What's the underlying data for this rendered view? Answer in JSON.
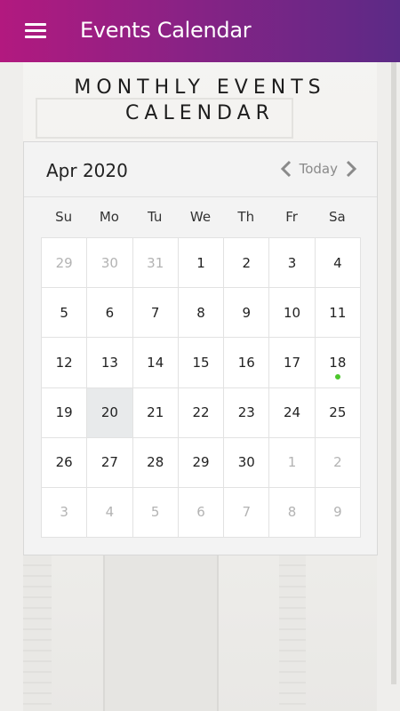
{
  "appbar": {
    "title": "Events Calendar"
  },
  "page": {
    "heading": "MONTHLY EVENTS CALENDAR"
  },
  "calendar": {
    "month_label": "Apr 2020",
    "today_label": "Today",
    "weekdays": [
      "Su",
      "Mo",
      "Tu",
      "We",
      "Th",
      "Fr",
      "Sa"
    ],
    "weeks": [
      [
        {
          "d": "29",
          "muted": true
        },
        {
          "d": "30",
          "muted": true
        },
        {
          "d": "31",
          "muted": true
        },
        {
          "d": "1"
        },
        {
          "d": "2"
        },
        {
          "d": "3"
        },
        {
          "d": "4"
        }
      ],
      [
        {
          "d": "5"
        },
        {
          "d": "6"
        },
        {
          "d": "7"
        },
        {
          "d": "8"
        },
        {
          "d": "9"
        },
        {
          "d": "10"
        },
        {
          "d": "11"
        }
      ],
      [
        {
          "d": "12"
        },
        {
          "d": "13"
        },
        {
          "d": "14"
        },
        {
          "d": "15"
        },
        {
          "d": "16"
        },
        {
          "d": "17"
        },
        {
          "d": "18",
          "event": true
        }
      ],
      [
        {
          "d": "19"
        },
        {
          "d": "20",
          "selected": true
        },
        {
          "d": "21"
        },
        {
          "d": "22"
        },
        {
          "d": "23"
        },
        {
          "d": "24"
        },
        {
          "d": "25"
        }
      ],
      [
        {
          "d": "26"
        },
        {
          "d": "27"
        },
        {
          "d": "28"
        },
        {
          "d": "29"
        },
        {
          "d": "30"
        },
        {
          "d": "1",
          "muted": true
        },
        {
          "d": "2",
          "muted": true
        }
      ],
      [
        {
          "d": "3",
          "muted": true
        },
        {
          "d": "4",
          "muted": true
        },
        {
          "d": "5",
          "muted": true
        },
        {
          "d": "6",
          "muted": true
        },
        {
          "d": "7",
          "muted": true
        },
        {
          "d": "8",
          "muted": true
        },
        {
          "d": "9",
          "muted": true
        }
      ]
    ]
  },
  "colors": {
    "appbar_start": "#b2197f",
    "appbar_end": "#5c2a86",
    "event_dot": "#4cc72c",
    "selected_day_bg": "#e8eaeb"
  },
  "icons": {
    "menu": "hamburger-menu-icon",
    "prev": "chevron-left-icon",
    "next": "chevron-right-icon"
  }
}
